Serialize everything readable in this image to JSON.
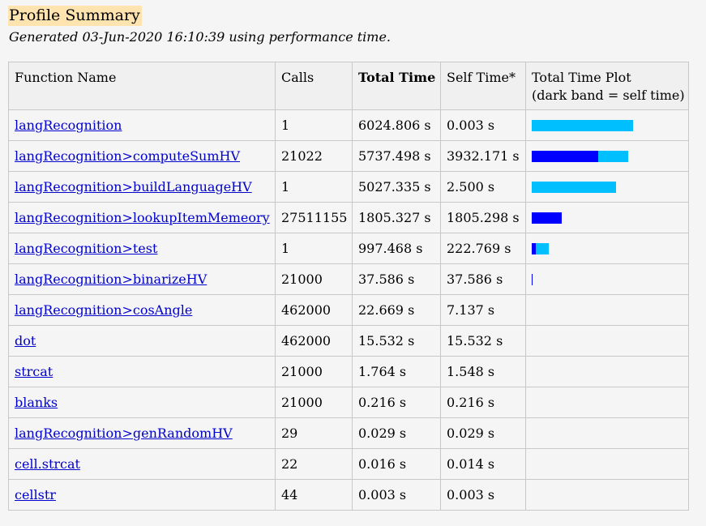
{
  "title": "Profile Summary",
  "subtitle": "Generated 03-Jun-2020 16:10:39 using performance time.",
  "colors": {
    "self_time_band": "#0000ff",
    "total_time_band": "#00bfff",
    "title_highlight": "#ffe4b0",
    "link": "#0000cc"
  },
  "table": {
    "headers": {
      "function_name": "Function Name",
      "calls": "Calls",
      "total_time": "Total Time",
      "self_time": "Self Time*",
      "plot_line1": "Total Time Plot",
      "plot_line2": "(dark band = self time)"
    },
    "max_total_seconds": 6024.806,
    "rows": [
      {
        "name": "langRecognition",
        "calls": "1",
        "total": "6024.806 s",
        "self": "0.003 s",
        "total_s": 6024.806,
        "self_s": 0.003,
        "plot": true
      },
      {
        "name": "langRecognition>computeSumHV",
        "calls": "21022",
        "total": "5737.498 s",
        "self": "3932.171 s",
        "total_s": 5737.498,
        "self_s": 3932.171,
        "plot": true
      },
      {
        "name": "langRecognition>buildLanguageHV",
        "calls": "1",
        "total": "5027.335 s",
        "self": "2.500 s",
        "total_s": 5027.335,
        "self_s": 2.5,
        "plot": true
      },
      {
        "name": "langRecognition>lookupItemMemeory",
        "calls": "27511155",
        "total": "1805.327 s",
        "self": "1805.298 s",
        "total_s": 1805.327,
        "self_s": 1805.298,
        "plot": true
      },
      {
        "name": "langRecognition>test",
        "calls": "1",
        "total": "997.468 s",
        "self": "222.769 s",
        "total_s": 997.468,
        "self_s": 222.769,
        "plot": true
      },
      {
        "name": "langRecognition>binarizeHV",
        "calls": "21000",
        "total": "37.586 s",
        "self": "37.586 s",
        "total_s": 37.586,
        "self_s": 37.586,
        "plot": true
      },
      {
        "name": "langRecognition>cosAngle",
        "calls": "462000",
        "total": "22.669 s",
        "self": "7.137 s",
        "total_s": 22.669,
        "self_s": 7.137,
        "plot": false
      },
      {
        "name": "dot",
        "calls": "462000",
        "total": "15.532 s",
        "self": "15.532 s",
        "total_s": 15.532,
        "self_s": 15.532,
        "plot": false
      },
      {
        "name": "strcat",
        "calls": "21000",
        "total": "1.764 s",
        "self": "1.548 s",
        "total_s": 1.764,
        "self_s": 1.548,
        "plot": false
      },
      {
        "name": "blanks",
        "calls": "21000",
        "total": "0.216 s",
        "self": "0.216 s",
        "total_s": 0.216,
        "self_s": 0.216,
        "plot": false
      },
      {
        "name": "langRecognition>genRandomHV",
        "calls": "29",
        "total": "0.029 s",
        "self": "0.029 s",
        "total_s": 0.029,
        "self_s": 0.029,
        "plot": false
      },
      {
        "name": "cell.strcat",
        "calls": "22",
        "total": "0.016 s",
        "self": "0.014 s",
        "total_s": 0.016,
        "self_s": 0.014,
        "plot": false
      },
      {
        "name": "cellstr",
        "calls": "44",
        "total": "0.003 s",
        "self": "0.003 s",
        "total_s": 0.003,
        "self_s": 0.003,
        "plot": false
      }
    ]
  }
}
